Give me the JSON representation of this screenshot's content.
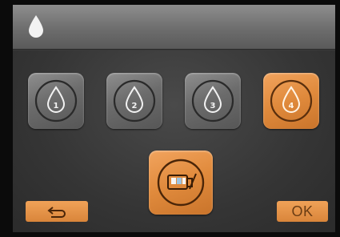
{
  "header": {
    "icon": "water-drop-icon"
  },
  "presets": [
    {
      "label": "1",
      "icon": "water-drop-icon",
      "selected": false
    },
    {
      "label": "2",
      "icon": "water-drop-icon",
      "selected": false
    },
    {
      "label": "3",
      "icon": "water-drop-icon",
      "selected": false
    },
    {
      "label": "4",
      "icon": "water-drop-icon",
      "selected": true
    }
  ],
  "fill_button": {
    "icon": "cup-fill-icon"
  },
  "footer": {
    "back_icon": "return-arrow-icon",
    "ok_label": "OK"
  },
  "colors": {
    "accent": "#e08a3c",
    "tile_gray": "#6c6c6c",
    "header": "#7a7a7a",
    "background": "#3a3a3a"
  }
}
